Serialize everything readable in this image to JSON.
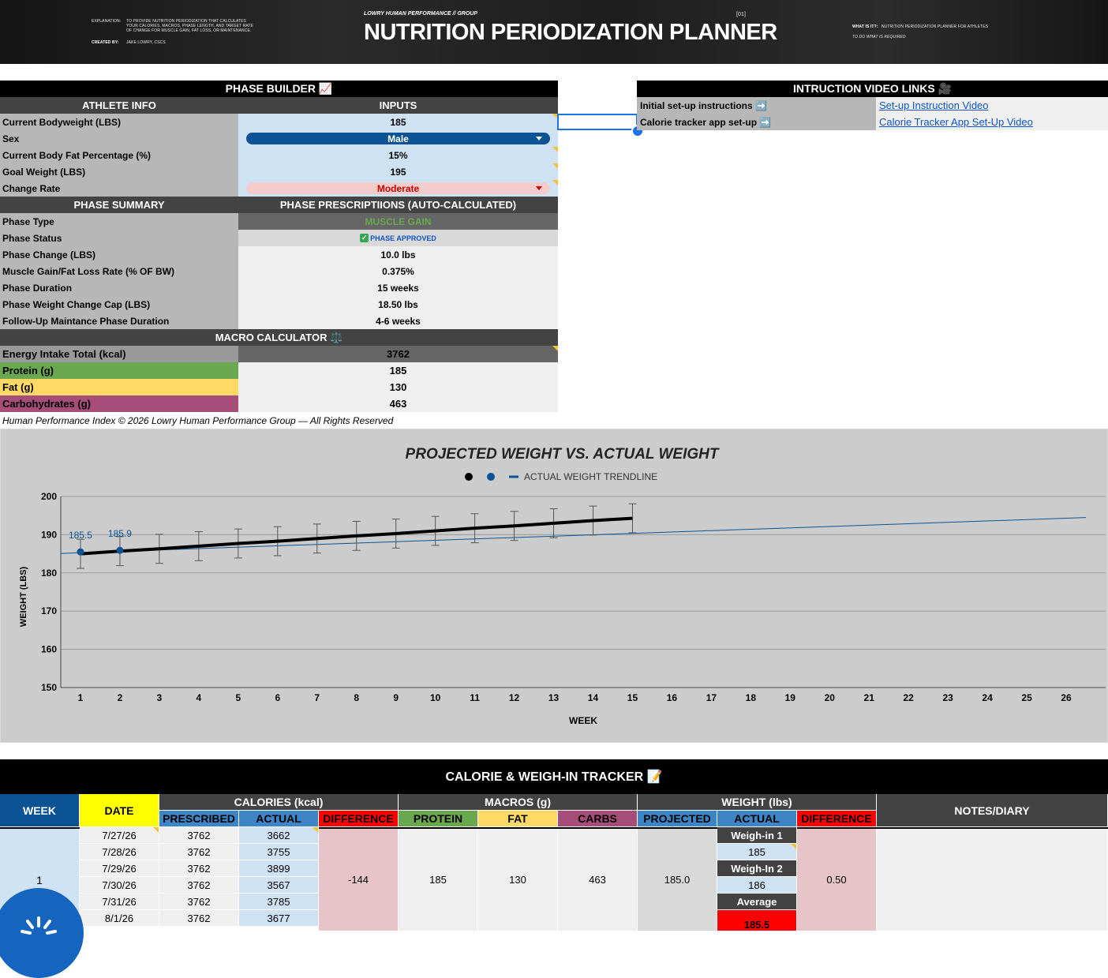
{
  "banner": {
    "explanation_label": "EXPLANATION:",
    "explanation_text": "TO PROVIDE NUTRITION PERIODIZATION THAT CALCULATES YOUR CALORIES, MACROS, PHASE LENGTH, AND TARGET RATE OF CHANGE FOR MUSCLE GAIN, FAT LOSS, OR MAINTENANCE.",
    "created_label": "CREATED BY:",
    "created_text": "JAKE LOWRY, CSCS",
    "kicker": "LOWRY HUMAN PERFORMANCE // GROUP",
    "number": "[01]",
    "title": "NUTRITION PERIODIZATION PLANNER",
    "what_label": "WHAT IS IT?:",
    "what_text": "NUTRITION PERIODIZATION PLANNER FOR ATHLETES",
    "tagline": "TO DO WHAT IS REQUIRED"
  },
  "phase_builder": {
    "title": "PHASE BUILDER 📈",
    "col_left": "ATHLETE INFO",
    "col_right": "INPUTS",
    "inputs": [
      {
        "label": "Current Bodyweight (LBS)",
        "value": "185"
      },
      {
        "label": "Sex",
        "value": "Male"
      },
      {
        "label": "Current Body Fat Percentage (%)",
        "value": "15%"
      },
      {
        "label": "Goal Weight (LBS)",
        "value": "195"
      },
      {
        "label": "Change Rate",
        "value": "Moderate"
      }
    ],
    "summary_left": "PHASE SUMMARY",
    "summary_right": "PHASE PRESCRIPTIIONS (AUTO-CALCULATED)",
    "summary": [
      {
        "label": "Phase Type",
        "value": "MUSCLE GAIN"
      },
      {
        "label": "Phase Status",
        "value": "PHASE APPROVED"
      },
      {
        "label": "Phase Change (LBS)",
        "value": "10.0 lbs"
      },
      {
        "label": "Muscle Gain/Fat Loss Rate (% OF BW)",
        "value": "0.375%"
      },
      {
        "label": "Phase Duration",
        "value": "15 weeks"
      },
      {
        "label": "Phase Weight Change Cap (LBS)",
        "value": "18.50 lbs"
      },
      {
        "label": "Follow-Up Maintance Phase Duration",
        "value": "4-6 weeks"
      }
    ],
    "macro_title": "MACRO CALCULATOR ⚖️",
    "macros": [
      {
        "label": "Energy Intake Total (kcal)",
        "value": "3762"
      },
      {
        "label": "Protein (g)",
        "value": "185"
      },
      {
        "label": "Fat (g)",
        "value": "130"
      },
      {
        "label": "Carbohydrates (g)",
        "value": "463"
      }
    ],
    "footer": "Human Performance Index © 2026 Lowry Human Performance Group — All Rights Reserved"
  },
  "video_links": {
    "title": "INTRUCTION VIDEO LINKS 🎥",
    "rows": [
      {
        "label": "Initial set-up instructions ➡️",
        "link": "Set-up Instruction Video"
      },
      {
        "label": "Calorie tracker app set-up ➡️",
        "link": "Calorie Tracker App Set-Up Video"
      }
    ]
  },
  "chart_data": {
    "type": "line",
    "title": "PROJECTED WEIGHT VS. ACTUAL WEIGHT",
    "legend": [
      "",
      "",
      "ACTUAL WEIGHT TRENDLINE"
    ],
    "xlabel": "WEEK",
    "ylabel": "WEIGHT (LBS)",
    "ylim": [
      150,
      200
    ],
    "yticks": [
      150,
      160,
      170,
      180,
      190,
      200
    ],
    "x": [
      1,
      2,
      3,
      4,
      5,
      6,
      7,
      8,
      9,
      10,
      11,
      12,
      13,
      14,
      15,
      16,
      17,
      18,
      19,
      20,
      21,
      22,
      23,
      24,
      25,
      26
    ],
    "series": [
      {
        "values": [
          185.0,
          185.7,
          186.3,
          187.0,
          187.7,
          188.3,
          189.0,
          189.7,
          190.3,
          191.0,
          191.7,
          192.3,
          193.0,
          193.7,
          194.3
        ],
        "error_bars": 3.8,
        "color": "#000000"
      },
      {
        "values": [
          185.5,
          185.9
        ],
        "labels": [
          "185.5",
          "185.9"
        ],
        "color": "#0b5394"
      },
      {
        "name": "ACTUAL WEIGHT TRENDLINE",
        "values_start": 185.1,
        "values_end": 194.5,
        "x_end": 26.5,
        "color": "#0b5394"
      }
    ],
    "grid": true
  },
  "tracker": {
    "title": "CALORIE & WEIGH-IN TRACKER 📝",
    "week_hdr": "WEEK",
    "date_hdr": "DATE",
    "calories_hdr": "CALORIES (kcal)",
    "macros_hdr": "MACROS (g)",
    "weight_hdr": "WEIGHT (lbs)",
    "notes_hdr": "NOTES/DIARY",
    "sub": {
      "prescribed": "PRESCRIBED",
      "actual": "ACTUAL",
      "difference": "DIFFERENCE",
      "protein": "PROTEIN",
      "fat": "FAT",
      "carbs": "CARBS",
      "projected": "PROJECTED",
      "w_actual": "ACTUAL",
      "w_difference": "DIFFERENCE"
    },
    "week": "1",
    "days": [
      {
        "date": "7/27/26",
        "prescribed": "3762",
        "actual": "3662"
      },
      {
        "date": "7/28/26",
        "prescribed": "3762",
        "actual": "3755"
      },
      {
        "date": "7/29/26",
        "prescribed": "3762",
        "actual": "3899"
      },
      {
        "date": "7/30/26",
        "prescribed": "3762",
        "actual": "3567"
      },
      {
        "date": "7/31/26",
        "prescribed": "3762",
        "actual": "3785"
      },
      {
        "date": "8/1/26",
        "prescribed": "3762",
        "actual": "3677"
      }
    ],
    "cal_difference": "-144",
    "protein": "185",
    "fat": "130",
    "carbs": "463",
    "projected": "185.0",
    "weigh1_label": "Weigh-in 1",
    "weigh1": "185",
    "weigh2_label": "Weigh-In 2",
    "weigh2": "186",
    "average_label": "Average",
    "average": "185.5",
    "w_difference": "0.50"
  }
}
